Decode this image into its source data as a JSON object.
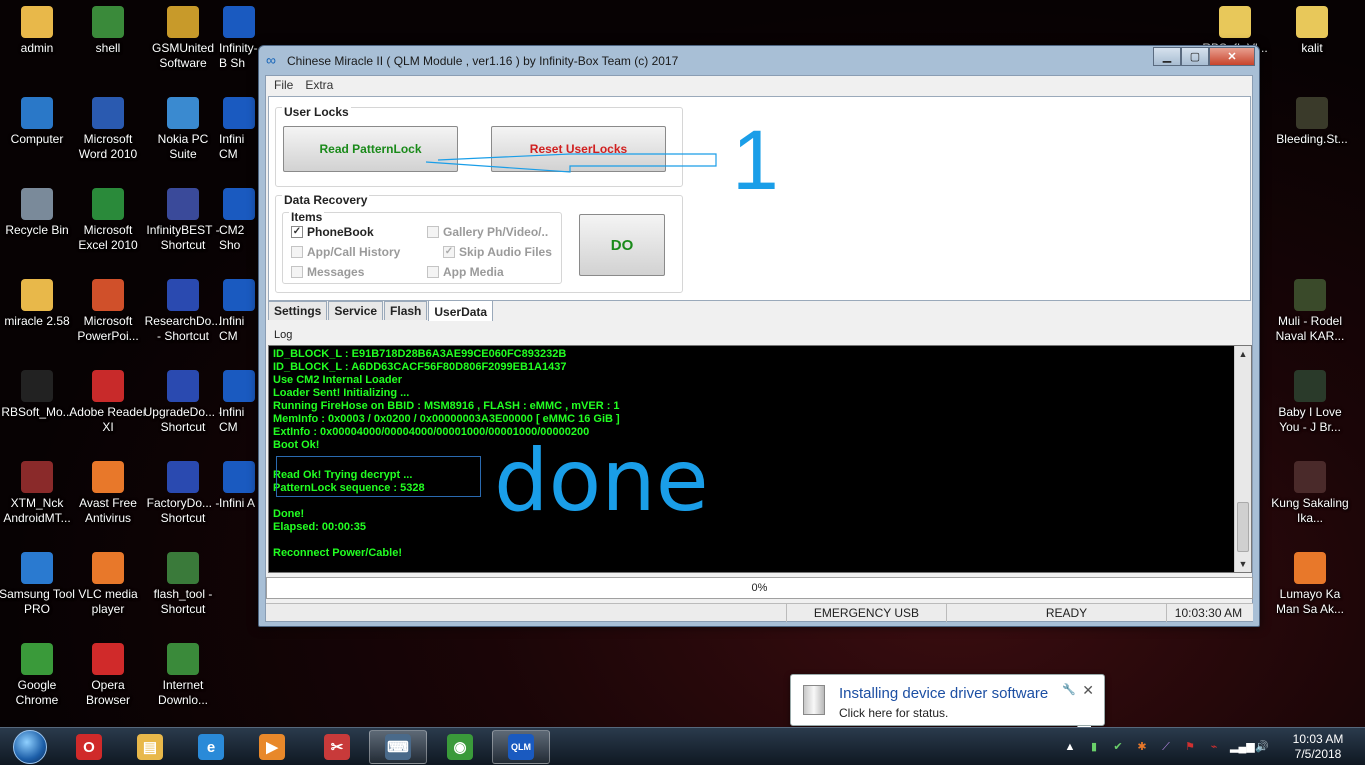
{
  "desktop": {
    "left_icons": [
      {
        "label": "admin",
        "icon": "folder-icon",
        "color": "#e8b84a"
      },
      {
        "label": "shell",
        "icon": "shield-shortcut-icon",
        "color": "#3a8a3a"
      },
      {
        "label": "GSMUnited Software",
        "icon": "gear-icon",
        "color": "#c89a2a"
      },
      {
        "label": "Infinity-B Sh",
        "icon": "infinity-icon",
        "color": "#1a5ac0"
      },
      {
        "label": "Computer",
        "icon": "computer-icon",
        "color": "#2a78c8"
      },
      {
        "label": "Microsoft Word 2010",
        "icon": "word-icon",
        "color": "#2a5ab0"
      },
      {
        "label": "Nokia PC Suite",
        "icon": "nokia-icon",
        "color": "#3a8ad0"
      },
      {
        "label": "Infini CM",
        "icon": "infinity-icon",
        "color": "#1a5ac0"
      },
      {
        "label": "Recycle Bin",
        "icon": "recycle-bin-icon",
        "color": "#7a8a9a"
      },
      {
        "label": "Microsoft Excel 2010",
        "icon": "excel-icon",
        "color": "#2a8a3a"
      },
      {
        "label": "InfinityBEST - Shortcut",
        "icon": "infinity-shortcut-icon",
        "color": "#3a4a9a"
      },
      {
        "label": "CM2 Sho",
        "icon": "infinity-icon",
        "color": "#1a5ac0"
      },
      {
        "label": "miracle 2.58",
        "icon": "folder-icon",
        "color": "#e8b84a"
      },
      {
        "label": "Microsoft PowerPoi...",
        "icon": "powerpoint-icon",
        "color": "#d0502a"
      },
      {
        "label": "ResearchDo... - Shortcut",
        "icon": "download-shortcut-icon",
        "color": "#2a4ab0"
      },
      {
        "label": "Infini CM",
        "icon": "infinity-icon",
        "color": "#1a5ac0"
      },
      {
        "label": "RBSoft_Mo...",
        "icon": "rbsoft-icon",
        "color": "#222222"
      },
      {
        "label": "Adobe Reader XI",
        "icon": "adobe-reader-icon",
        "color": "#c82a2a"
      },
      {
        "label": "UpgradeDo... - Shortcut",
        "icon": "download-shortcut-icon",
        "color": "#2a4ab0"
      },
      {
        "label": "Infini CM",
        "icon": "infinity-icon",
        "color": "#1a5ac0"
      },
      {
        "label": "XTM_Nck AndroidMT...",
        "icon": "xtm-icon",
        "color": "#8a2a2a"
      },
      {
        "label": "Avast Free Antivirus",
        "icon": "avast-icon",
        "color": "#e8782a"
      },
      {
        "label": "FactoryDo... - Shortcut",
        "icon": "download-shortcut-icon",
        "color": "#2a4ab0"
      },
      {
        "label": "Infini A",
        "icon": "infinity-icon",
        "color": "#1a5ac0"
      },
      {
        "label": "Samsung Tool PRO",
        "icon": "samsung-tool-icon",
        "color": "#2a7ad0"
      },
      {
        "label": "VLC media player",
        "icon": "vlc-icon",
        "color": "#e8782a"
      },
      {
        "label": "flash_tool - Shortcut",
        "icon": "flash-tool-icon",
        "color": "#3a7a3a"
      },
      {
        "label": "",
        "icon": "",
        "color": ""
      },
      {
        "label": "Google Chrome",
        "icon": "chrome-icon",
        "color": "#3a9a3a"
      },
      {
        "label": "Opera Browser",
        "icon": "opera-icon",
        "color": "#d02a2a"
      },
      {
        "label": "Internet Downlo...",
        "icon": "idm-icon",
        "color": "#3a8a3a"
      }
    ],
    "right_icons": [
      {
        "label": "RBS_fL.Vl...",
        "icon": "folder-icon",
        "color": "#e8c85a"
      },
      {
        "label": "kalit",
        "icon": "folder-icon",
        "color": "#e8c85a"
      },
      {
        "label": "Bleeding.St...",
        "icon": "video-icon",
        "color": "#3a3a2a"
      },
      {
        "label": "Muli - Rodel Naval KAR...",
        "icon": "video-icon",
        "color": "#3a4a2a"
      },
      {
        "label": "Baby I Love You - J Br...",
        "icon": "video-icon",
        "color": "#2a3a2a"
      },
      {
        "label": "Kung Sakaling Ika...",
        "icon": "video-icon",
        "color": "#4a2a2a"
      },
      {
        "label": "Lumayo Ka Man Sa Ak...",
        "icon": "vlc-icon",
        "color": "#e8782a"
      }
    ]
  },
  "window": {
    "title": "Chinese Miracle II ( QLM Module , ver1.16 ) by Infinity-Box Team (c) 2017",
    "minimize_label": "▁",
    "maximize_label": "▢",
    "close_label": "✕",
    "menu": [
      "File",
      "Extra"
    ],
    "user_locks": {
      "title": "User Locks",
      "read_btn": "Read PatternLock",
      "reset_btn": "Reset UserLocks"
    },
    "data_recovery": {
      "title": "Data Recovery",
      "items_title": "Items",
      "checks": [
        {
          "label": "PhoneBook",
          "checked": true,
          "enabled": true
        },
        {
          "label": "Gallery Ph/Video/..",
          "checked": false,
          "enabled": false
        },
        {
          "label": "App/Call History",
          "checked": false,
          "enabled": false
        },
        {
          "label": "Skip Audio Files",
          "checked": true,
          "enabled": false
        },
        {
          "label": "Messages",
          "checked": false,
          "enabled": false
        },
        {
          "label": "App Media",
          "checked": false,
          "enabled": false
        }
      ],
      "do_btn": "DO"
    },
    "tabs": [
      "Settings",
      "Service",
      "Flash",
      "UserData"
    ],
    "active_tab": "UserData",
    "log_label": "Log",
    "log_lines": [
      "ID_BLOCK_L : E91B718D28B6A3AE99CE060FC893232B",
      "ID_BLOCK_L : A6DD63CACF56F80D806F2099EB1A1437",
      "Use CM2 Internal Loader",
      "Loader Sent! Initializing ...",
      "Running FireHose on BBID : MSM8916 , FLASH : eMMC , mVER : 1",
      "MemInfo : 0x0003 / 0x0200 / 0x00000003A3E00000 [ eMMC 16 GiB ]",
      "ExtInfo : 0x00004000/00004000/00001000/00001000/00000200",
      "Boot Ok!",
      "",
      "Read Ok! Trying decrypt ...",
      "PatternLock sequence : 5328",
      "",
      "Done!",
      "Elapsed: 00:00:35",
      "",
      "Reconnect Power/Cable!"
    ],
    "progress_text": "0%",
    "progress": 0,
    "status": {
      "mode": "EMERGENCY USB",
      "state": "READY",
      "time": "10:03:30 AM"
    }
  },
  "annotations": {
    "number": "1",
    "done": "done",
    "color": "#1a9ee8"
  },
  "notification": {
    "title": "Installing device driver software",
    "body": "Click here for status.",
    "close": "✕"
  },
  "taskbar": {
    "apps": [
      {
        "name": "opera",
        "icon": "opera-icon",
        "color": "#d02a2a",
        "glyph": "O"
      },
      {
        "name": "explorer",
        "icon": "folder-icon",
        "color": "#e8b84a",
        "glyph": "▤"
      },
      {
        "name": "ie",
        "icon": "ie-icon",
        "color": "#2a8ad8",
        "glyph": "e"
      },
      {
        "name": "media",
        "icon": "media-player-icon",
        "color": "#e8882a",
        "glyph": "▶"
      },
      {
        "name": "tool",
        "icon": "snipping-tool-icon",
        "color": "#c83a3a",
        "glyph": "✂"
      },
      {
        "name": "keyboard",
        "icon": "on-screen-keyboard-icon",
        "color": "#4a6a8a",
        "glyph": "⌨"
      },
      {
        "name": "chrome",
        "icon": "chrome-icon",
        "color": "#3a9a3a",
        "glyph": "◉"
      },
      {
        "name": "qlm",
        "icon": "infinity-icon",
        "color": "#1a5ac0",
        "glyph": "QLM"
      }
    ],
    "clock_time": "10:03 AM",
    "clock_date": "7/5/2018"
  }
}
